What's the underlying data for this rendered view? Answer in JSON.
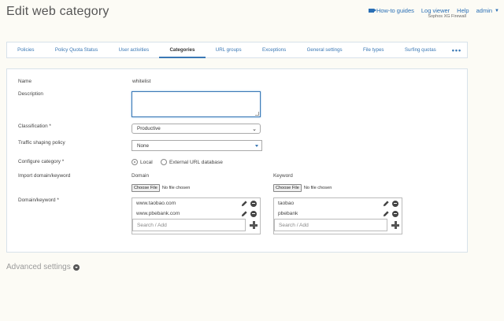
{
  "page": {
    "title": "Edit web category"
  },
  "topbar": {
    "how_to_guides": "How-to guides",
    "log_viewer": "Log viewer",
    "help": "Help",
    "user": "admin",
    "product": "Sophos XG Firewall"
  },
  "tabs": [
    {
      "label": "Policies"
    },
    {
      "label": "Policy Quota Status"
    },
    {
      "label": "User activities"
    },
    {
      "label": "Categories",
      "active": true
    },
    {
      "label": "URL groups"
    },
    {
      "label": "Exceptions"
    },
    {
      "label": "General settings"
    },
    {
      "label": "File types"
    },
    {
      "label": "Surfing quotas"
    },
    {
      "label": "•••"
    }
  ],
  "form": {
    "name_label": "Name",
    "name_value": "whitelist",
    "description_label": "Description",
    "description_value": "",
    "classification_label": "Classification *",
    "classification_value": "Productive",
    "traffic_label": "Traffic shaping policy",
    "traffic_value": "None",
    "configure_label": "Configure category *",
    "configure_options": [
      "Local",
      "External URL database"
    ],
    "configure_selected": "Local",
    "import_label": "Import domain/keyword",
    "domain_header": "Domain",
    "keyword_header": "Keyword",
    "choose_file": "Choose File",
    "no_file": "No file chosen",
    "dk_label": "Domain/keyword *",
    "domains": [
      "www.taobao.com",
      "www.pbebank.com"
    ],
    "keywords": [
      "taobao",
      "pbebank"
    ],
    "add_placeholder": "Search / Add"
  },
  "advanced": {
    "label": "Advanced settings"
  },
  "colors": {
    "accent": "#3a78b5",
    "background": "#fcfbf5"
  }
}
